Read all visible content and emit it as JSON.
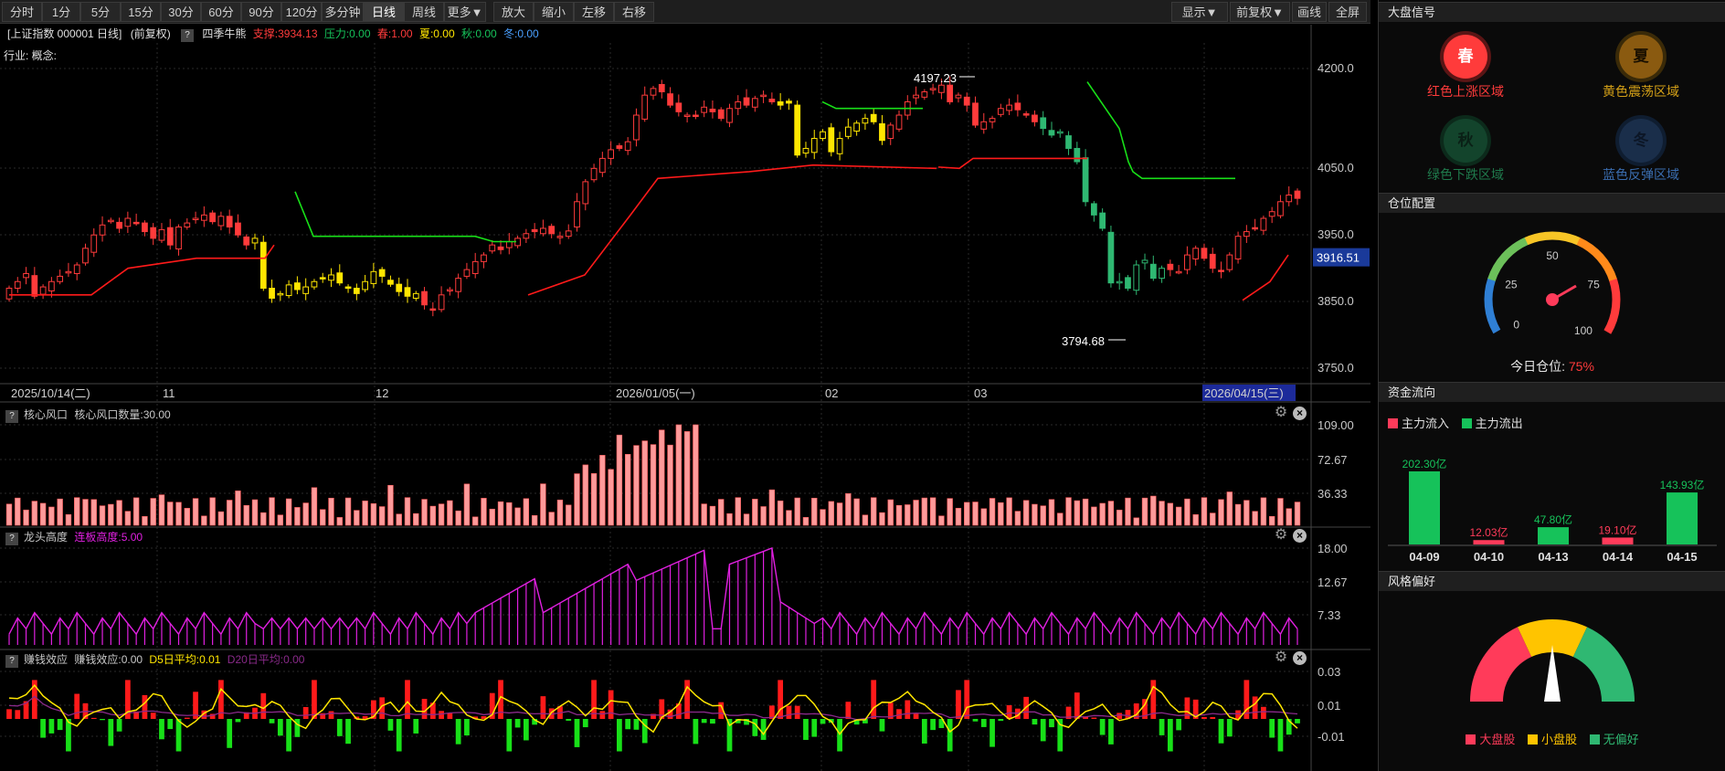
{
  "toolbar": {
    "periods": [
      "分时",
      "1分",
      "5分",
      "15分",
      "30分",
      "60分",
      "90分",
      "120分",
      "多分钟",
      "日线",
      "周线",
      "更多▼"
    ],
    "active": "日线",
    "actions": [
      "放大",
      "缩小",
      "左移",
      "右移"
    ],
    "right": [
      "显示▼",
      "前复权▼",
      "画线",
      "全屏"
    ]
  },
  "info": {
    "index": "[上证指数 000001 日线]",
    "adj": "(前复权)",
    "indicator": "四季牛熊",
    "support": "支撑:3934.13",
    "pressure": "压力:0.00",
    "spring": "春:1.00",
    "summer": "夏:0.00",
    "autumn": "秋:0.00",
    "winter": "冬:0.00",
    "industry": "行业: 概念:"
  },
  "main_chart": {
    "y_ticks": [
      "4200.0",
      "4050.0",
      "3950.0",
      "3850.0",
      "3750.0"
    ],
    "current_price": "3916.51",
    "high_label": "4197.23",
    "low_label": "3794.68",
    "x_labels": [
      "2025/10/14(二)",
      "11",
      "12",
      "2026/01/05(一)",
      "02",
      "03",
      "2026/04/15(三)"
    ]
  },
  "panel1": {
    "title": "核心风口",
    "sub": "核心风口数量:30.00",
    "ticks": [
      "109.00",
      "72.67",
      "36.33"
    ]
  },
  "panel2": {
    "title": "龙头高度",
    "sub": "连板高度:5.00",
    "ticks": [
      "18.00",
      "12.67",
      "7.33"
    ]
  },
  "panel3": {
    "title": "赚钱效应",
    "sub": "赚钱效应:0.00",
    "d5": "D5日平均:0.01",
    "d20": "D20日平均:0.00",
    "ticks": [
      "0.03",
      "0.01",
      "-0.01"
    ]
  },
  "signals": {
    "header": "大盘信号",
    "items": [
      {
        "glyph": "春",
        "label": "红色上涨区域"
      },
      {
        "glyph": "夏",
        "label": "黄色震荡区域"
      },
      {
        "glyph": "秋",
        "label": "绿色下跌区域"
      },
      {
        "glyph": "冬",
        "label": "蓝色反弹区域"
      }
    ]
  },
  "position": {
    "header": "仓位配置",
    "gauge_ticks": [
      "0",
      "25",
      "50",
      "75",
      "100"
    ],
    "today_label": "今日仓位:",
    "today_value": "75%",
    "level_pct": 75
  },
  "fundflow": {
    "header": "资金流向",
    "legend_in": "主力流入",
    "legend_out": "主力流出",
    "bars": [
      {
        "date": "04-09",
        "label": "202.30亿",
        "value": 202.3,
        "dir": "out"
      },
      {
        "date": "04-10",
        "label": "12.03亿",
        "value": 12.03,
        "dir": "in"
      },
      {
        "date": "04-13",
        "label": "47.80亿",
        "value": 47.8,
        "dir": "out"
      },
      {
        "date": "04-14",
        "label": "19.10亿",
        "value": 19.1,
        "dir": "in"
      },
      {
        "date": "04-15",
        "label": "143.93亿",
        "value": 143.93,
        "dir": "out"
      }
    ]
  },
  "style": {
    "header": "风格偏好",
    "legend": [
      "大盘股",
      "小盘股",
      "无偏好"
    ]
  },
  "colors": {
    "up": "#ff3b3b",
    "down": "#16c25a",
    "yellow": "#ffe600",
    "magenta": "#e020e0",
    "bar_pink": "#ff9a9a"
  }
}
